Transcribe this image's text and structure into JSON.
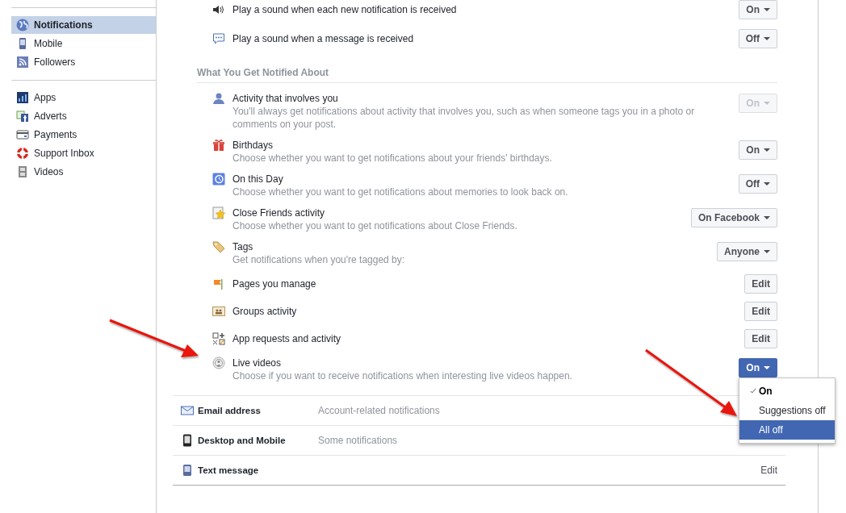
{
  "sidebar": {
    "groups": [
      {
        "items": [
          {
            "label": "Notifications",
            "selected": true
          },
          {
            "label": "Mobile",
            "selected": false
          },
          {
            "label": "Followers",
            "selected": false
          }
        ]
      },
      {
        "items": [
          {
            "label": "Apps",
            "selected": false
          },
          {
            "label": "Adverts",
            "selected": false
          },
          {
            "label": "Payments",
            "selected": false
          },
          {
            "label": "Support Inbox",
            "selected": false
          },
          {
            "label": "Videos",
            "selected": false
          }
        ]
      }
    ]
  },
  "sound_settings": [
    {
      "label": "Play a sound when each new notification is received",
      "control": {
        "kind": "select",
        "value": "On"
      }
    },
    {
      "label": "Play a sound when a message is received",
      "control": {
        "kind": "select",
        "value": "Off"
      }
    }
  ],
  "section_heading": "What You Get Notified About",
  "notify_items": [
    {
      "title": "Activity that involves you",
      "description": "You'll always get notifications about activity that involves you, such as when someone tags you in a photo or comments on your post.",
      "control": {
        "kind": "select",
        "value": "On",
        "disabled": true
      }
    },
    {
      "title": "Birthdays",
      "description": "Choose whether you want to get notifications about your friends' birthdays.",
      "control": {
        "kind": "select",
        "value": "On"
      }
    },
    {
      "title": "On this Day",
      "description": "Choose whether you want to get notifications about memories to look back on.",
      "control": {
        "kind": "select",
        "value": "Off"
      }
    },
    {
      "title": "Close Friends activity",
      "description": "Choose whether you want to get notifications about Close Friends.",
      "control": {
        "kind": "select",
        "value": "On Facebook"
      }
    },
    {
      "title": "Tags",
      "description": "Get notifications when you're tagged by:",
      "control": {
        "kind": "select",
        "value": "Anyone"
      }
    },
    {
      "title": "Pages you manage",
      "control": {
        "kind": "edit",
        "value": "Edit"
      }
    },
    {
      "title": "Groups activity",
      "control": {
        "kind": "edit",
        "value": "Edit"
      }
    },
    {
      "title": "App requests and activity",
      "control": {
        "kind": "edit",
        "value": "Edit"
      }
    },
    {
      "title": "Live videos",
      "description": "Choose if you want to receive notifications when interesting live videos happen.",
      "control": {
        "kind": "select",
        "value": "On",
        "open": true,
        "menu": [
          {
            "label": "On",
            "selected": true,
            "highlighted": false
          },
          {
            "label": "Suggestions off",
            "selected": false,
            "highlighted": false
          },
          {
            "label": "All off",
            "selected": false,
            "highlighted": true
          }
        ]
      }
    }
  ],
  "channels": [
    {
      "name": "Email address",
      "summary": "Account-related notifications"
    },
    {
      "name": "Desktop and Mobile",
      "summary": "Some notifications"
    },
    {
      "name": "Text message",
      "link": "Edit"
    }
  ]
}
